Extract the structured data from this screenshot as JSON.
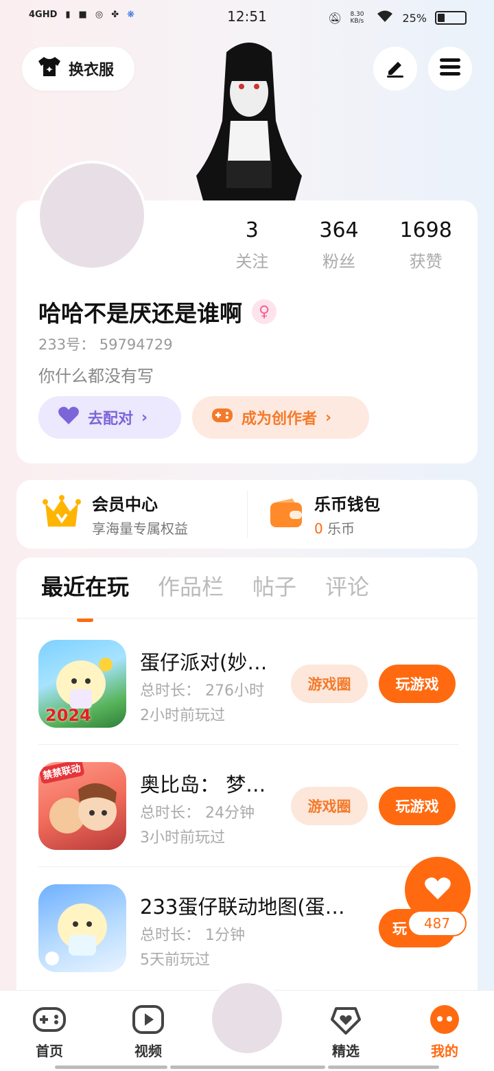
{
  "status_bar": {
    "network": "4GHD",
    "time": "12:51",
    "speed": "8.30 KB/s",
    "battery_percent": "25%",
    "battery_level": 0.25
  },
  "top": {
    "wardrobe_label": "换衣服"
  },
  "profile": {
    "stats": [
      {
        "value": "3",
        "label": "关注"
      },
      {
        "value": "364",
        "label": "粉丝"
      },
      {
        "value": "1698",
        "label": "获赞"
      }
    ],
    "username": "哈哈不是厌还是谁啊",
    "gender_symbol": "♀",
    "uid": "233号： 59794729",
    "bio": "你什么都没有写",
    "match_label": "去配对",
    "creator_label": "成为创作者"
  },
  "wallet": {
    "vip_title": "会员中心",
    "vip_sub": "享海量专属权益",
    "coin_title": "乐币钱包",
    "coin_amount": "0",
    "coin_unit": "乐币"
  },
  "tabs": [
    "最近在玩",
    "作品栏",
    "帖子",
    "评论"
  ],
  "games": [
    {
      "name": "蛋仔派对(妙…",
      "duration": "总时长： 276小时",
      "last_played": "2小时前玩过",
      "circle_label": "游戏圈",
      "play_label": "玩游戏"
    },
    {
      "name": "奥比岛： 梦…",
      "duration": "总时长： 24分钟",
      "last_played": "3小时前玩过",
      "circle_label": "游戏圈",
      "play_label": "玩游戏"
    },
    {
      "name": "233蛋仔联动地图(蛋…",
      "duration": "总时长： 1分钟",
      "last_played": "5天前玩过",
      "circle_label": "",
      "play_label": "玩"
    }
  ],
  "icon_badges": {
    "game1": "2024",
    "game2": "禁禁联动"
  },
  "like_count": "487",
  "bottom_nav": [
    {
      "label": "首页",
      "icon": "gamepad-icon"
    },
    {
      "label": "视频",
      "icon": "play-icon"
    },
    {
      "label": "精选",
      "icon": "heart-bubble-icon"
    },
    {
      "label": "我的",
      "icon": "face-icon"
    }
  ],
  "colors": {
    "accent": "#ff6a10",
    "purple": "#7c65d9"
  }
}
